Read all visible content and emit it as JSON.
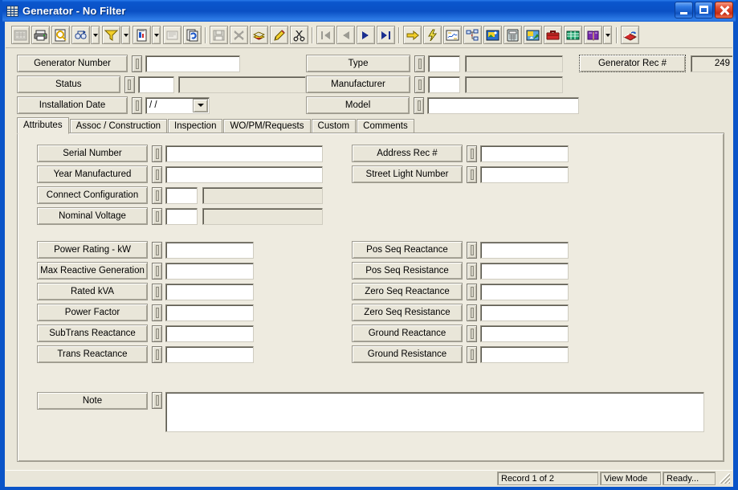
{
  "window": {
    "title": "Generator  - No Filter",
    "icon": "grid-icon",
    "min_label": "Minimize",
    "max_label": "Maximize",
    "close_label": "Close"
  },
  "toolbar": {
    "buttons": [
      {
        "name": "grid-view-icon",
        "label": "Grid View",
        "enabled": false,
        "arrow": false
      },
      {
        "name": "print-icon",
        "label": "Print",
        "enabled": true,
        "arrow": false
      },
      {
        "name": "print-preview-icon",
        "label": "Print Preview",
        "enabled": true,
        "arrow": false
      },
      {
        "name": "find-icon",
        "label": "Find",
        "enabled": true,
        "arrow": true
      },
      {
        "name": "filter-icon",
        "label": "Filter",
        "enabled": true,
        "arrow": true
      },
      {
        "name": "report-icon",
        "label": "Report",
        "enabled": true,
        "arrow": true
      },
      {
        "name": "form-design-icon",
        "label": "Form Design",
        "enabled": false,
        "arrow": false
      },
      {
        "name": "refresh-record-icon",
        "label": "Refresh",
        "enabled": true,
        "arrow": false
      },
      {
        "name": "separator",
        "label": "",
        "enabled": true,
        "arrow": false
      },
      {
        "name": "save-icon",
        "label": "Save",
        "enabled": false,
        "arrow": false
      },
      {
        "name": "delete-icon",
        "label": "Delete",
        "enabled": false,
        "arrow": false
      },
      {
        "name": "copy-record-icon",
        "label": "Copy Record",
        "enabled": true,
        "arrow": false
      },
      {
        "name": "edit-icon",
        "label": "Edit",
        "enabled": true,
        "arrow": false
      },
      {
        "name": "cut-icon",
        "label": "Cut",
        "enabled": true,
        "arrow": false
      },
      {
        "name": "separator",
        "label": "",
        "enabled": true,
        "arrow": false
      },
      {
        "name": "first-record-icon",
        "label": "First Record",
        "enabled": false,
        "arrow": false
      },
      {
        "name": "previous-record-icon",
        "label": "Previous Record",
        "enabled": false,
        "arrow": false
      },
      {
        "name": "next-record-icon",
        "label": "Next Record",
        "enabled": true,
        "arrow": false
      },
      {
        "name": "last-record-icon",
        "label": "Last Record",
        "enabled": true,
        "arrow": false
      },
      {
        "name": "separator",
        "label": "",
        "enabled": true,
        "arrow": false
      },
      {
        "name": "goto-icon",
        "label": "Go To",
        "enabled": true,
        "arrow": false
      },
      {
        "name": "quick-action-icon",
        "label": "Quick Action",
        "enabled": true,
        "arrow": false
      },
      {
        "name": "map-icon",
        "label": "Map",
        "enabled": true,
        "arrow": false
      },
      {
        "name": "tree-view-icon",
        "label": "Tree View",
        "enabled": true,
        "arrow": false
      },
      {
        "name": "image-icon",
        "label": "Images",
        "enabled": true,
        "arrow": false
      },
      {
        "name": "calculator-icon",
        "label": "Calculator",
        "enabled": true,
        "arrow": false
      },
      {
        "name": "sketch-icon",
        "label": "Sketch",
        "enabled": true,
        "arrow": false
      },
      {
        "name": "toolbox-icon",
        "label": "Toolbox",
        "enabled": true,
        "arrow": false
      },
      {
        "name": "spreadsheet-icon",
        "label": "Spreadsheet",
        "enabled": true,
        "arrow": false
      },
      {
        "name": "help-book-icon",
        "label": "Help",
        "enabled": true,
        "arrow": true
      },
      {
        "name": "separator",
        "label": "",
        "enabled": true,
        "arrow": false
      },
      {
        "name": "export-icon",
        "label": "Export",
        "enabled": true,
        "arrow": false
      }
    ]
  },
  "header": {
    "left_fields": [
      {
        "label": "Generator Number",
        "value": "",
        "type": "text"
      },
      {
        "label": "Status",
        "value": "",
        "type": "code-desc"
      },
      {
        "label": "Installation Date",
        "value": "  /  /",
        "type": "date"
      }
    ],
    "mid_fields": [
      {
        "label": "Type",
        "value": "",
        "type": "code-desc"
      },
      {
        "label": "Manufacturer",
        "value": "",
        "type": "code-desc"
      },
      {
        "label": "Model",
        "value": "",
        "type": "text"
      }
    ],
    "rec_button": "Generator Rec #",
    "rec_value": "249"
  },
  "tabs": [
    {
      "label": "Attributes",
      "active": true
    },
    {
      "label": "Assoc / Construction",
      "active": false
    },
    {
      "label": "Inspection",
      "active": false
    },
    {
      "label": "WO/PM/Requests",
      "active": false
    },
    {
      "label": "Custom",
      "active": false
    },
    {
      "label": "Comments",
      "active": false
    }
  ],
  "attributes": {
    "group1_left": [
      {
        "label": "Serial Number",
        "value": "",
        "type": "text"
      },
      {
        "label": "Year Manufactured",
        "value": "",
        "type": "text"
      },
      {
        "label": "Connect Configuration",
        "value": "",
        "type": "code-desc"
      },
      {
        "label": "Nominal Voltage",
        "value": "",
        "type": "code-desc"
      }
    ],
    "group1_right": [
      {
        "label": "Address Rec #",
        "value": "",
        "type": "text"
      },
      {
        "label": "Street Light Number",
        "value": "",
        "type": "text"
      }
    ],
    "group2_left": [
      {
        "label": "Power Rating - kW",
        "value": "",
        "type": "text"
      },
      {
        "label": "Max Reactive Generation",
        "value": "",
        "type": "text"
      },
      {
        "label": "Rated kVA",
        "value": "",
        "type": "text"
      },
      {
        "label": "Power Factor",
        "value": "",
        "type": "text"
      },
      {
        "label": "SubTrans Reactance",
        "value": "",
        "type": "text"
      },
      {
        "label": "Trans Reactance",
        "value": "",
        "type": "text"
      }
    ],
    "group2_right": [
      {
        "label": "Pos Seq Reactance",
        "value": "",
        "type": "text"
      },
      {
        "label": "Pos Seq Resistance",
        "value": "",
        "type": "text"
      },
      {
        "label": "Zero Seq Reactance",
        "value": "",
        "type": "text"
      },
      {
        "label": "Zero Seq Resistance",
        "value": "",
        "type": "text"
      },
      {
        "label": "Ground Reactance",
        "value": "",
        "type": "text"
      },
      {
        "label": "Ground Resistance",
        "value": "",
        "type": "text"
      }
    ],
    "note": {
      "label": "Note",
      "value": ""
    }
  },
  "status_bar": {
    "record": "Record 1 of 2",
    "mode": "View Mode",
    "state": "Ready..."
  },
  "colors": {
    "title_blue": "#0a50c4",
    "face": "#e9e6d9",
    "panel": "#eeebe0",
    "close_red": "#c32a12"
  }
}
